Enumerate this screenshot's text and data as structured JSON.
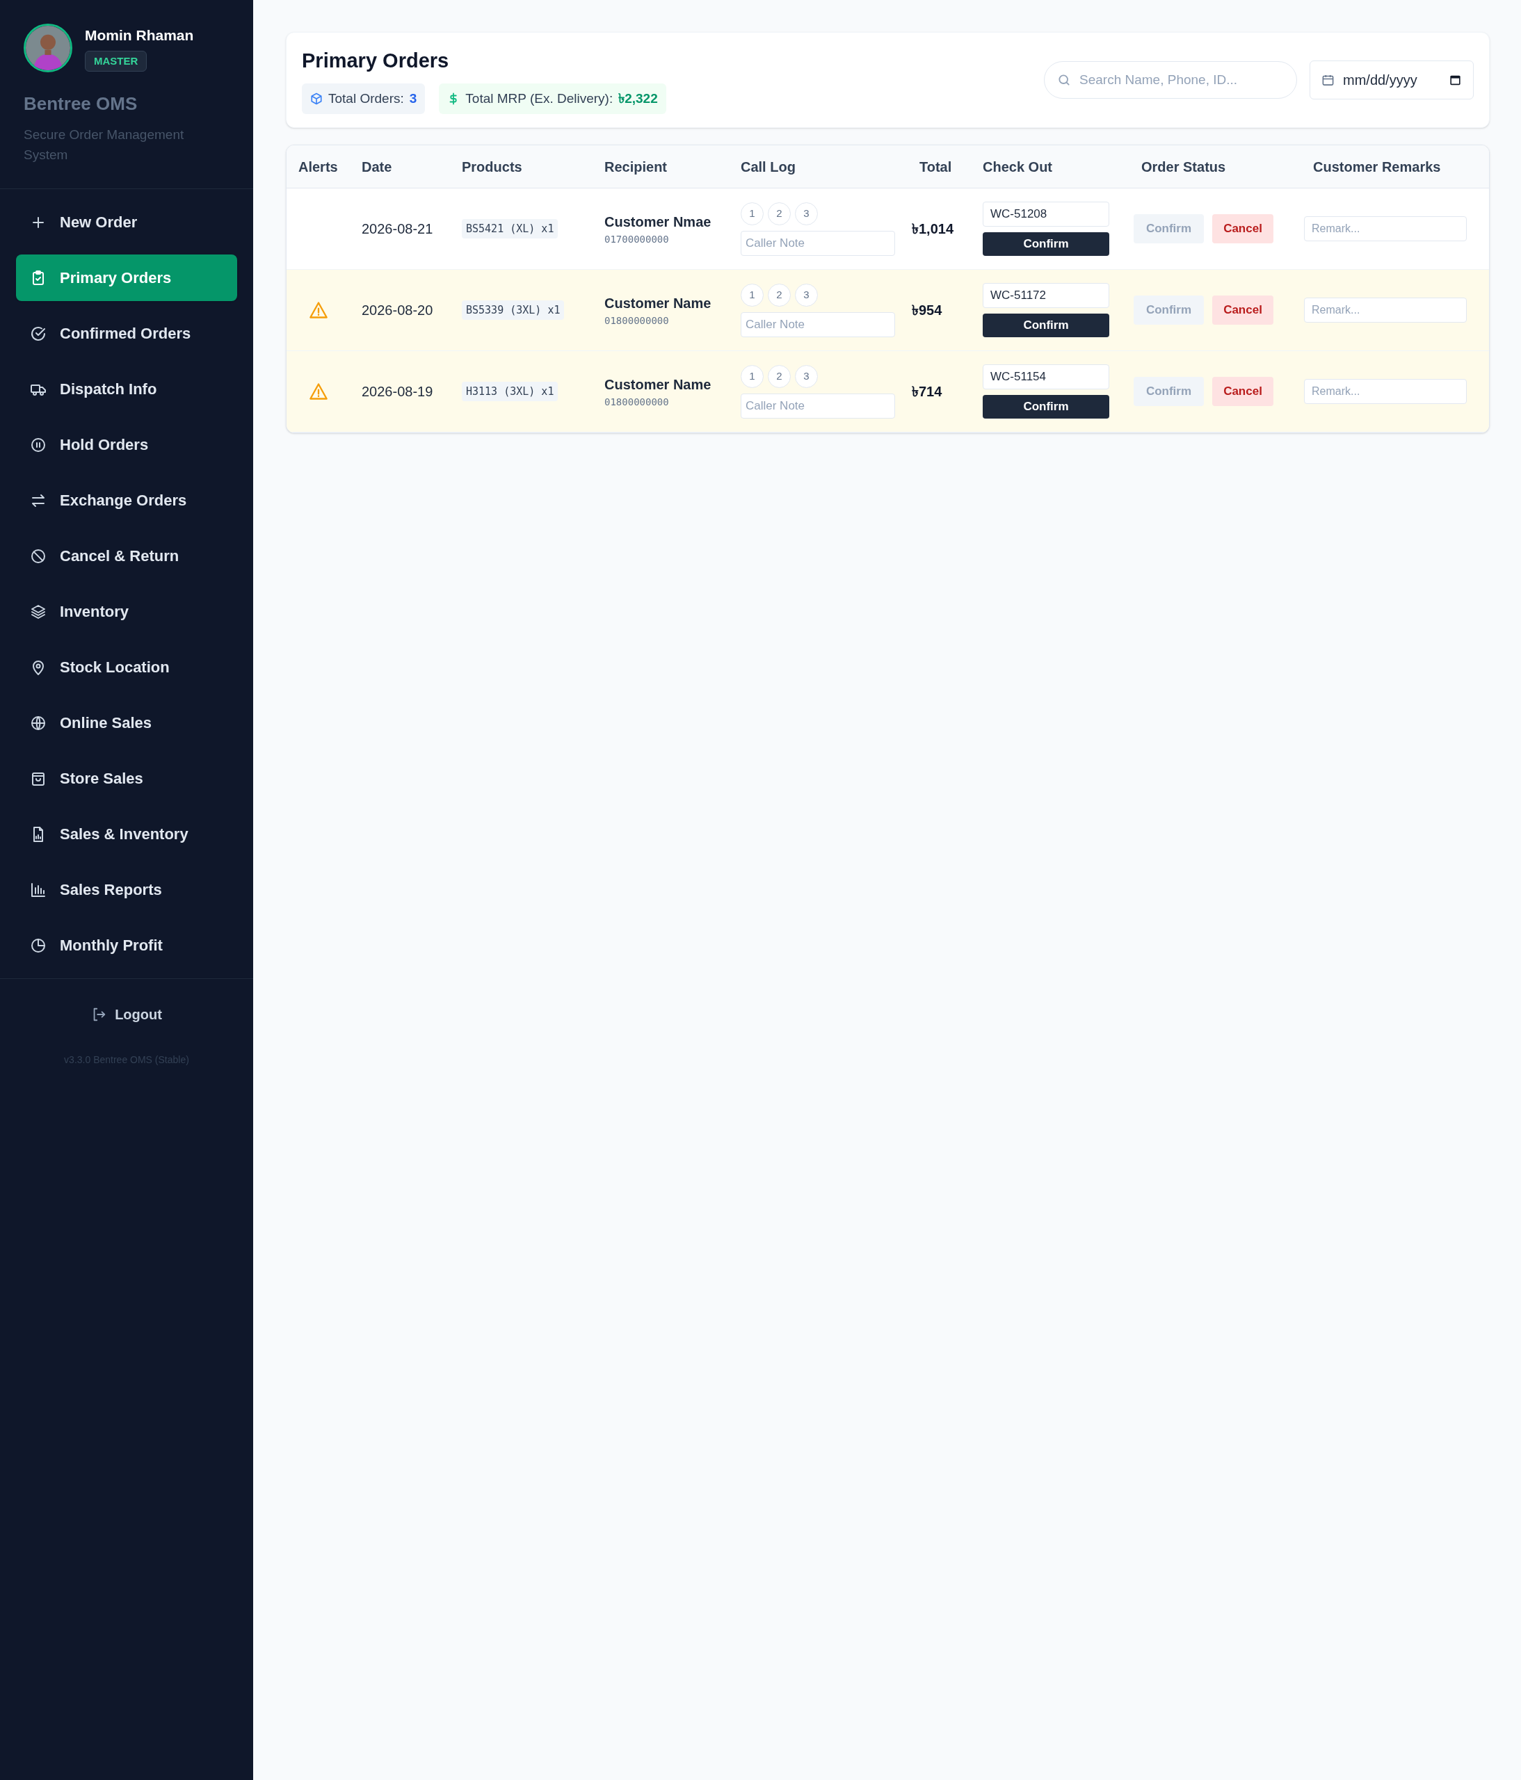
{
  "user": {
    "name": "Momin Rhaman",
    "role": "MASTER"
  },
  "brand": {
    "title": "Bentree OMS",
    "subtitle": "Secure Order Management System"
  },
  "sidebar": {
    "items": [
      {
        "label": "New Order",
        "selected": false
      },
      {
        "label": "Primary Orders",
        "selected": true
      },
      {
        "label": "Confirmed Orders",
        "selected": false
      },
      {
        "label": "Dispatch Info",
        "selected": false
      },
      {
        "label": "Hold Orders",
        "selected": false
      },
      {
        "label": "Exchange Orders",
        "selected": false
      },
      {
        "label": "Cancel & Return",
        "selected": false
      },
      {
        "label": "Inventory",
        "selected": false
      },
      {
        "label": "Stock Location",
        "selected": false
      },
      {
        "label": "Online Sales",
        "selected": false
      },
      {
        "label": "Store Sales",
        "selected": false
      },
      {
        "label": "Sales & Inventory",
        "selected": false
      },
      {
        "label": "Sales Reports",
        "selected": false
      },
      {
        "label": "Monthly Profit",
        "selected": false
      }
    ],
    "logout": "Logout",
    "version": "v3.3.0 Bentree OMS (Stable)"
  },
  "header": {
    "title": "Primary Orders",
    "total_orders_label": "Total Orders:",
    "total_orders": "3",
    "total_mrp_label": "Total MRP (Ex. Delivery):",
    "total_mrp": "৳2,322",
    "search": {
      "placeholder": "Search Name, Phone, ID..."
    },
    "date": {
      "placeholder": "mm/dd/yyyy"
    }
  },
  "table": {
    "columns": [
      "Alerts",
      "Date",
      "Products",
      "Recipient",
      "Call Log",
      "Total",
      "Check Out",
      "Order Status",
      "Customer Remarks"
    ],
    "rows": [
      {
        "alert": false,
        "date": "2026-08-21",
        "product": "BS5421 (XL) x1",
        "name": "Customer Nmae",
        "phone": "01700000000",
        "calls": [
          "1",
          "2",
          "3"
        ],
        "caller_note": {
          "placeholder": "Caller Note"
        },
        "total": "৳1,014",
        "checkout_id": "WC-51208",
        "checkout_button": "Confirm",
        "status_confirm": "Confirm",
        "status_cancel": "Cancel",
        "remark": {
          "placeholder": "Remark..."
        }
      },
      {
        "alert": true,
        "date": "2026-08-20",
        "product": "BS5339 (3XL) x1",
        "name": "Customer Name",
        "phone": "01800000000",
        "calls": [
          "1",
          "2",
          "3"
        ],
        "caller_note": {
          "placeholder": "Caller Note"
        },
        "total": "৳954",
        "checkout_id": "WC-51172",
        "checkout_button": "Confirm",
        "status_confirm": "Confirm",
        "status_cancel": "Cancel",
        "remark": {
          "placeholder": "Remark..."
        }
      },
      {
        "alert": true,
        "date": "2026-08-19",
        "product": "H3113 (3XL) x1",
        "name": "Customer Name",
        "phone": "01800000000",
        "calls": [
          "1",
          "2",
          "3"
        ],
        "caller_note": {
          "placeholder": "Caller Note"
        },
        "total": "৳714",
        "checkout_id": "WC-51154",
        "checkout_button": "Confirm",
        "status_confirm": "Confirm",
        "status_cancel": "Cancel",
        "remark": {
          "placeholder": "Remark..."
        }
      }
    ]
  }
}
